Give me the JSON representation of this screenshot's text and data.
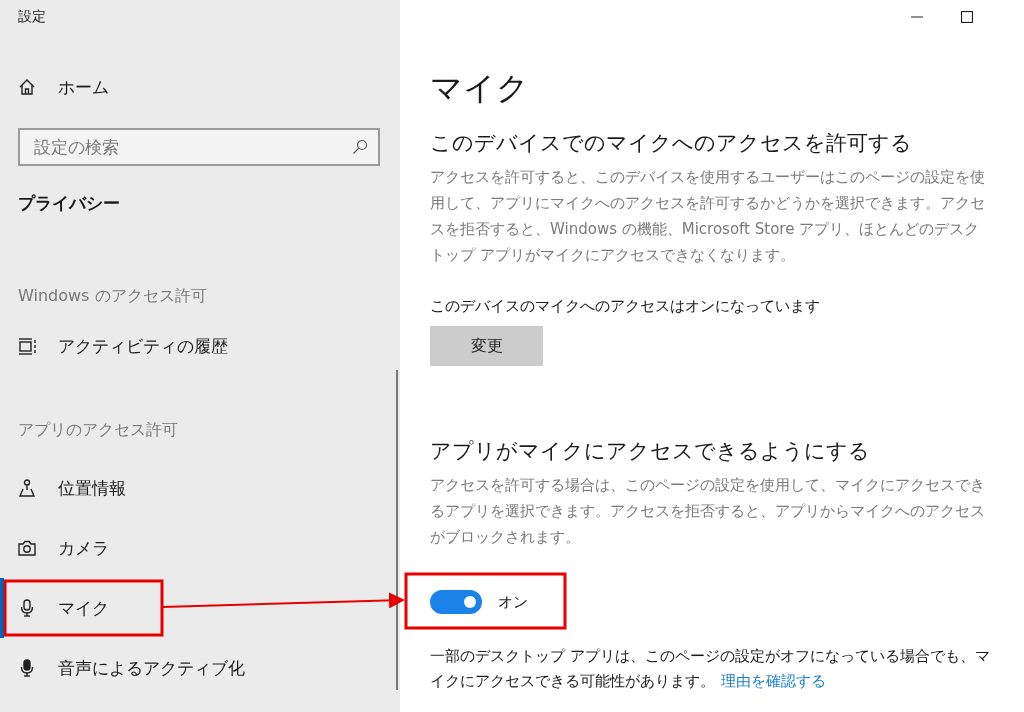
{
  "window": {
    "title": "設定"
  },
  "sidebar": {
    "home": {
      "label": "ホーム"
    },
    "search": {
      "placeholder": "設定の検索"
    },
    "category": "プライバシー",
    "groups": [
      {
        "header": "Windows のアクセス許可",
        "items": [
          {
            "label": "アクティビティの履歴",
            "kind": "activity",
            "selected": false
          }
        ]
      },
      {
        "header": "アプリのアクセス許可",
        "items": [
          {
            "label": "位置情報",
            "kind": "location",
            "selected": false
          },
          {
            "label": "カメラ",
            "kind": "camera",
            "selected": false
          },
          {
            "label": "マイク",
            "kind": "microphone",
            "selected": true
          },
          {
            "label": "音声によるアクティブ化",
            "kind": "voice",
            "selected": false
          }
        ]
      }
    ]
  },
  "content": {
    "title": "マイク",
    "sections": [
      {
        "heading": "このデバイスでのマイクへのアクセスを許可する",
        "description": "アクセスを許可すると、このデバイスを使用するユーザーはこのページの設定を使用して、アプリにマイクへのアクセスを許可するかどうかを選択できます。アクセスを拒否すると、Windows の機能、Microsoft Store アプリ、ほとんどのデスクトップ アプリがマイクにアクセスできなくなります。",
        "status": "このデバイスのマイクへのアクセスはオンになっています",
        "button": "変更"
      },
      {
        "heading": "アプリがマイクにアクセスできるようにする",
        "description": "アクセスを許可する場合は、このページの設定を使用して、マイクにアクセスできるアプリを選択できます。アクセスを拒否すると、アプリからマイクへのアクセスがブロックされます。",
        "toggle": {
          "on": true,
          "label": "オン"
        },
        "note": {
          "text": "一部のデスクトップ アプリは、このページの設定がオフになっている場合でも、マイクにアクセスできる可能性があります。",
          "link": "理由を確認する"
        }
      }
    ]
  }
}
